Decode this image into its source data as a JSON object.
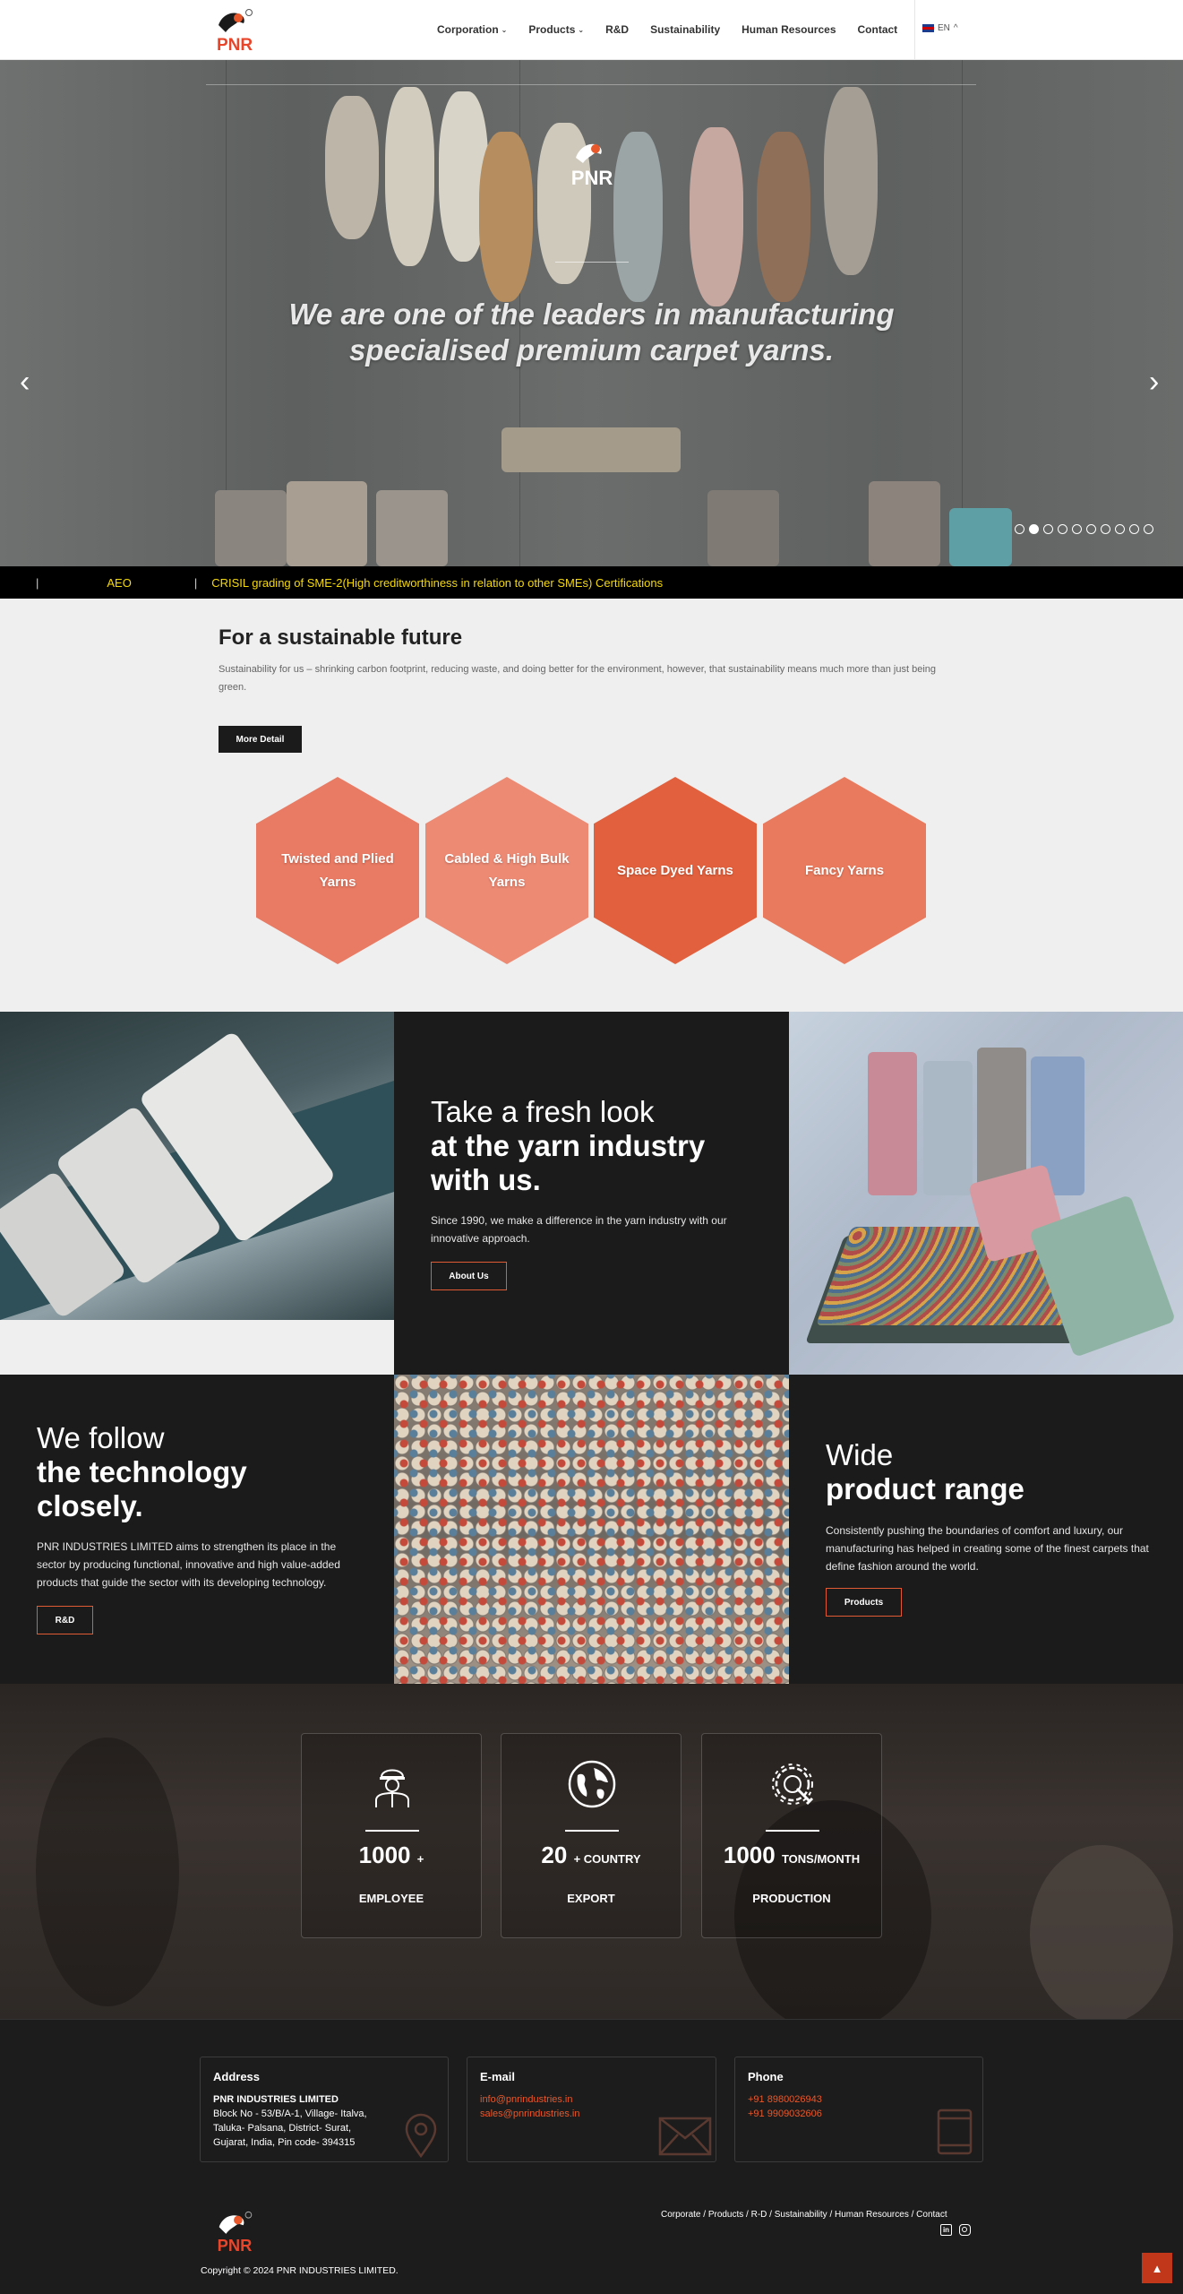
{
  "header": {
    "logo_text": "PNR",
    "nav": [
      {
        "label": "Corporation",
        "dropdown": true
      },
      {
        "label": "Products",
        "dropdown": true
      },
      {
        "label": "R&D",
        "dropdown": false
      },
      {
        "label": "Sustainability",
        "dropdown": false
      },
      {
        "label": "Human Resources",
        "dropdown": false
      },
      {
        "label": "Contact",
        "dropdown": false
      }
    ],
    "language": "EN"
  },
  "hero": {
    "logo_text": "PNR",
    "headline_line1": "We are one of the leaders in manufacturing",
    "headline_line2": "specialised premium carpet yarns.",
    "slide_count": 10,
    "active_slide": 2
  },
  "ticker": {
    "items": [
      "AEO",
      "CRISIL grading of SME-2(High creditworthiness in relation to other SMEs) Certifications"
    ]
  },
  "sustainability": {
    "title": "For a sustainable future",
    "body": "Sustainability for us – shrinking carbon footprint, reducing waste, and doing better for the environment, however, that sustainability means much more than just being green.",
    "button": "More Detail"
  },
  "products": [
    {
      "label": "Twisted and Plied Yarns",
      "color": "#e97a63"
    },
    {
      "label": "Cabled & High Bulk Yarns",
      "color": "#ec8a74"
    },
    {
      "label": "Space Dyed Yarns",
      "color": "#e2603d"
    },
    {
      "label": "Fancy Yarns",
      "color": "#ea7a5d"
    }
  ],
  "fresh_look": {
    "light": "Take a fresh look",
    "bold1": "at the yarn industry",
    "bold2": "with us.",
    "body": "Since 1990, we make a difference in the yarn industry with our innovative approach.",
    "button": "About Us"
  },
  "technology": {
    "light": "We follow",
    "bold1": "the technology",
    "bold2": "closely.",
    "body": "PNR INDUSTRIES LIMITED aims to strengthen its place in the sector by producing functional, innovative and high value-added products that guide the sector with its developing technology.",
    "button": "R&D"
  },
  "range": {
    "light": "Wide",
    "bold": "product range",
    "body": "Consistently pushing the boundaries of comfort and luxury, our manufacturing has helped in creating some of the finest carpets that define fashion around the world.",
    "button": "Products"
  },
  "stats": [
    {
      "icon": "worker-icon",
      "number": "1000",
      "suffix": "+",
      "label": "EMPLOYEE"
    },
    {
      "icon": "globe-icon",
      "number": "20",
      "suffix": "+ COUNTRY",
      "label": "EXPORT"
    },
    {
      "icon": "gear-wrench-icon",
      "number": "1000",
      "suffix": "TONS/MONTH",
      "label": "PRODUCTION"
    }
  ],
  "footer": {
    "address": {
      "title": "Address",
      "company": "PNR INDUSTRIES LIMITED",
      "line1": "Block No - 53/B/A-1, Village- Italva,",
      "line2": "Taluka- Palsana, District- Surat,",
      "line3": "Gujarat, India, Pin code- 394315"
    },
    "email": {
      "title": "E-mail",
      "line1": "info@pnrindustries.in",
      "line2": "sales@pnrindustries.in"
    },
    "phone": {
      "title": "Phone",
      "line1": "+91 8980026943",
      "line2": "+91 9909032606"
    },
    "links": [
      "Corporate",
      "Products",
      "R-D",
      "Sustainability",
      "Human Resources",
      "Contact"
    ],
    "copyright": "Copyright © 2024 PNR INDUSTRIES LIMITED."
  },
  "colors": {
    "accent": "#e05a33",
    "dark": "#1b1b1c",
    "ticker_text": "#f5d90a"
  }
}
